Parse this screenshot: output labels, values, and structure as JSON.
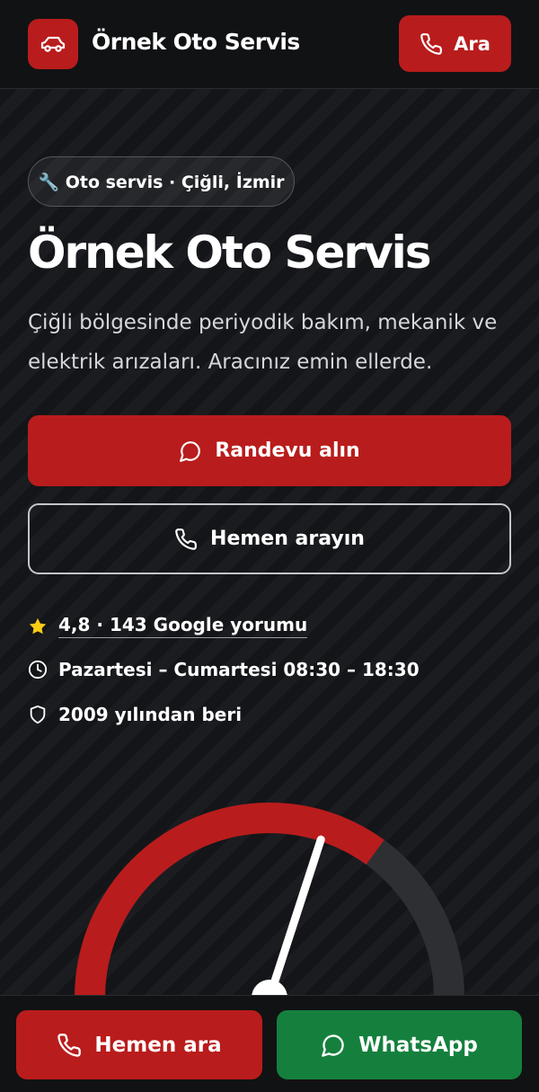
{
  "header": {
    "brand": "Örnek Oto Servis",
    "call_label": "Ara",
    "logo_icon": "car-icon"
  },
  "hero": {
    "badge": "🔧 Oto servis · Çiğli, İzmir",
    "title": "Örnek Oto Servis",
    "description": "Çiğli bölgesinde periyodik bakım, mekanik ve elektrik arızaları. Aracınız emin ellerde.",
    "primary_button": "Randevu alın",
    "secondary_button": "Hemen arayın"
  },
  "info": {
    "rating": "4,8 · 143 Google yorumu",
    "hours": "Pazartesi – Cumartesi 08:30 – 18:30",
    "since": "2009 yılından beri"
  },
  "gauge": {
    "level": 0.7,
    "accent": "#b91c1c",
    "track": "#2e2f33"
  },
  "bottom_bar": {
    "call_label": "Hemen ara",
    "whatsapp_label": "WhatsApp"
  },
  "colors": {
    "brand_red": "#b91c1c",
    "whatsapp_green": "#15803d",
    "background": "#141518"
  }
}
